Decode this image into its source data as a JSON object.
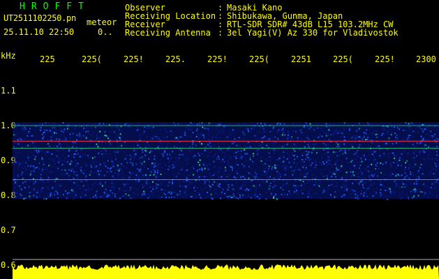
{
  "header": {
    "logo": "HROFFT",
    "filename": "UT2511102250.pn",
    "filename_suffix": "meteor",
    "datetime": "25.11.10 22:50",
    "datetime_value": "0.."
  },
  "info": [
    {
      "label": "Observer",
      "sep": ":",
      "value": "Masaki Kano"
    },
    {
      "label": "Receiving Location",
      "sep": ":",
      "value": "Shibukawa, Gunma, Japan"
    },
    {
      "label": "Receiver",
      "sep": ":",
      "value": "RTL-SDR SDR# 43dB L15 103.2MHz CW"
    },
    {
      "label": "Receiving Antenna",
      "sep": ":",
      "value": "3el Yagi(V) Az 330 for Vladivostok"
    }
  ],
  "chart_data": {
    "type": "heatmap",
    "ylabel": "kHz",
    "yticks": [
      "1.1",
      "1.0",
      "0.9",
      "0.8",
      "0.7",
      "0.6"
    ],
    "ytick_values": [
      1.1,
      1.0,
      0.9,
      0.8,
      0.7,
      0.6
    ],
    "ylim": [
      0.6,
      1.15
    ],
    "xticks": [
      "225",
      "225(",
      "225!",
      "225.",
      "225!",
      "225(",
      "2251",
      "225(",
      "225!",
      "2300"
    ],
    "signal_band_khz": [
      0.79,
      1.01
    ],
    "carrier_lines_khz": [
      1.0,
      0.955,
      0.935,
      0.845
    ],
    "colors": {
      "background": "#000000",
      "labels": "#ffff00",
      "logo": "#00ff00",
      "noise_low": "#0a1a8c",
      "noise_mid": "#1e5cff",
      "noise_high": "#22dd88",
      "carrier": "#ff3333",
      "level_bar": "#ffff00",
      "axis_line": "#ffffff"
    }
  }
}
